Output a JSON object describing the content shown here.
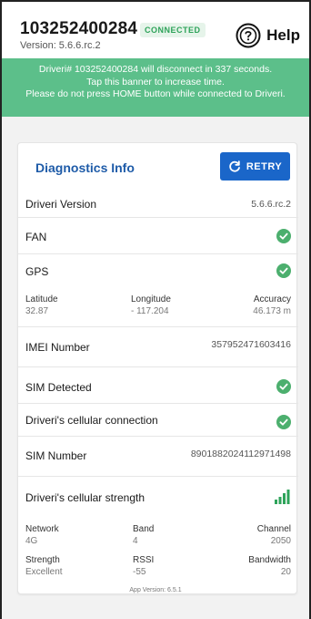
{
  "header": {
    "device_id": "103252400284",
    "status_badge": "CONNECTED",
    "version": "Version: 5.6.6.rc.2",
    "help_label": "Help"
  },
  "banner": {
    "line1": "Driveri# 103252400284 will disconnect in 337 seconds.",
    "line2": "Tap this banner to increase time.",
    "line3": "Please do not press HOME button while connected to Driveri."
  },
  "diagnostics": {
    "title": "Diagnostics Info",
    "retry_label": "RETRY",
    "driveri_version": {
      "label": "Driveri Version",
      "value": "5.6.6.rc.2"
    },
    "fan": {
      "label": "FAN",
      "status": "ok"
    },
    "gps": {
      "label": "GPS",
      "status": "ok"
    },
    "location": {
      "latitude_label": "Latitude",
      "latitude": "32.87",
      "longitude_label": "Longitude",
      "longitude": "- 117.204",
      "accuracy_label": "Accuracy",
      "accuracy": "46.173 m"
    },
    "imei": {
      "label": "IMEI Number",
      "value": "357952471603416"
    },
    "sim_detected": {
      "label": "SIM Detected",
      "status": "ok"
    },
    "cellular_connection": {
      "label": "Driveri's cellular connection",
      "status": "ok"
    },
    "sim_number": {
      "label": "SIM Number",
      "value": "8901882024112971498"
    },
    "cellular_strength": {
      "label": "Driveri's cellular strength",
      "bars": 4,
      "network_label": "Network",
      "network": "4G",
      "band_label": "Band",
      "band": "4",
      "channel_label": "Channel",
      "channel": "2050",
      "strength_label": "Strength",
      "strength": "Excellent",
      "rssi_label": "RSSI",
      "rssi": "-55",
      "bandwidth_label": "Bandwidth",
      "bandwidth": "20"
    }
  },
  "footer": {
    "app_version": "App Version: 6.5.1"
  },
  "colors": {
    "accent": "#1a66c9",
    "success": "#2ea35a",
    "banner": "#5cbf8a",
    "title": "#1e5ba8"
  }
}
